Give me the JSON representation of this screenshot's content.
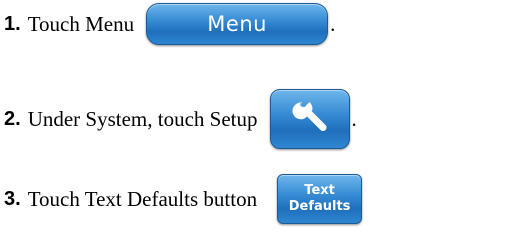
{
  "steps": [
    {
      "number": "1.",
      "text": "Touch Menu",
      "trailing": ".",
      "button": {
        "label": "Menu"
      }
    },
    {
      "number": "2.",
      "text": "Under System, touch Setup",
      "trailing": ".",
      "button": {
        "icon": "wrench-icon"
      }
    },
    {
      "number": "3.",
      "text": "Touch Text Defaults button",
      "trailing": "",
      "button": {
        "label_line1": "Text",
        "label_line2": "Defaults"
      }
    }
  ],
  "colors": {
    "button_top": "#6fb6ec",
    "button_mid": "#3a8fd6",
    "button_bottom": "#1f6fbc",
    "button_border": "#1a5b97",
    "text": "#000000"
  }
}
